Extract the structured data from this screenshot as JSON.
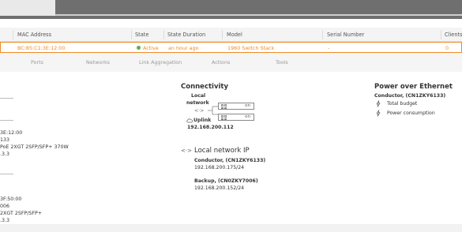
{
  "table": {
    "headers": [
      "MAC Address",
      "State",
      "State Duration",
      "Model",
      "Serial Number",
      "Clients"
    ],
    "row": {
      "mac": "BC:85:C1:3E:12:00",
      "state": "Active",
      "duration": "an hour ago",
      "model": "1960 Switch Stack",
      "serial": "-",
      "clients": "0"
    }
  },
  "tabs": [
    "Ports",
    "Networks",
    "Link Aggregation",
    "Actions",
    "Tools"
  ],
  "left_panel": {
    "member1": [
      "3E:12:00",
      "133",
      "PoE 2XGT 2SFP/SFP+ 370W",
      ".3.3"
    ],
    "member2": [
      "3F:50:00",
      "006",
      "2XGT 2SFP/SFP+",
      ".3.3"
    ]
  },
  "connectivity": {
    "title": "Connectivity",
    "local_network_label": "Local\nnetwork",
    "local_line1": "Local",
    "local_line2": "network",
    "arrow": "<·>",
    "port_state": "on",
    "uplink_label": "Uplink",
    "uplink_ip": "192.168.200.112"
  },
  "local_ip": {
    "title": "Local network IP",
    "arrow": "<·>",
    "conductor_label": "Conductor, (CN1ZKY6133)",
    "conductor_ip": "192.168.200.175/24",
    "backup_label": "Backup, (CN0ZKY7006)",
    "backup_ip": "192.168.200.152/24"
  },
  "poe": {
    "title": "Power over Ethernet",
    "conductor_label": "Conductor, (CN1ZKY6133)",
    "total_budget": "Total budget",
    "power_consumption": "Power consumption"
  },
  "colors": {
    "accent": "#f08a24",
    "active": "#58b24a",
    "topbar": "#6f6f6f"
  }
}
